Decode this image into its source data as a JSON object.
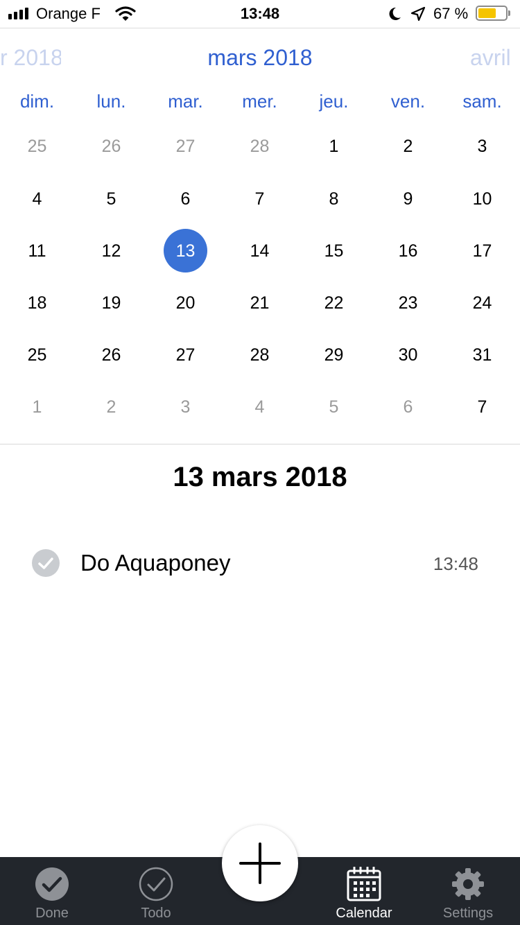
{
  "status_bar": {
    "carrier": "Orange F",
    "time": "13:48",
    "battery_percent": "67 %",
    "battery_level": 0.67,
    "battery_color": "#f5c400"
  },
  "calendar": {
    "prev_month": "r 2018",
    "current_month": "mars 2018",
    "next_month": "avril",
    "weekdays": [
      "dim.",
      "lun.",
      "mar.",
      "mer.",
      "jeu.",
      "ven.",
      "sam."
    ],
    "weeks": [
      [
        "25",
        "26",
        "27",
        "28",
        "1",
        "2",
        "3"
      ],
      [
        "4",
        "5",
        "6",
        "7",
        "8",
        "9",
        "10"
      ],
      [
        "11",
        "12",
        "13",
        "14",
        "15",
        "16",
        "17"
      ],
      [
        "18",
        "19",
        "20",
        "21",
        "22",
        "23",
        "24"
      ],
      [
        "25",
        "26",
        "27",
        "28",
        "29",
        "30",
        "31"
      ],
      [
        "1",
        "2",
        "3",
        "4",
        "5",
        "6",
        "7"
      ]
    ],
    "selected_day": "13",
    "accent_color": "#3a72d6"
  },
  "day_view": {
    "date_title": "13 mars 2018",
    "tasks": [
      {
        "title": "Do Aquaponey",
        "time": "13:48",
        "done": true
      }
    ]
  },
  "tab_bar": {
    "tabs": [
      {
        "label": "Done",
        "icon": "check-filled-icon",
        "active": false
      },
      {
        "label": "Todo",
        "icon": "check-outline-icon",
        "active": false
      },
      {
        "label": "Calendar",
        "icon": "calendar-icon",
        "active": true
      },
      {
        "label": "Settings",
        "icon": "gear-icon",
        "active": false
      }
    ],
    "add_button_icon": "plus-icon"
  }
}
